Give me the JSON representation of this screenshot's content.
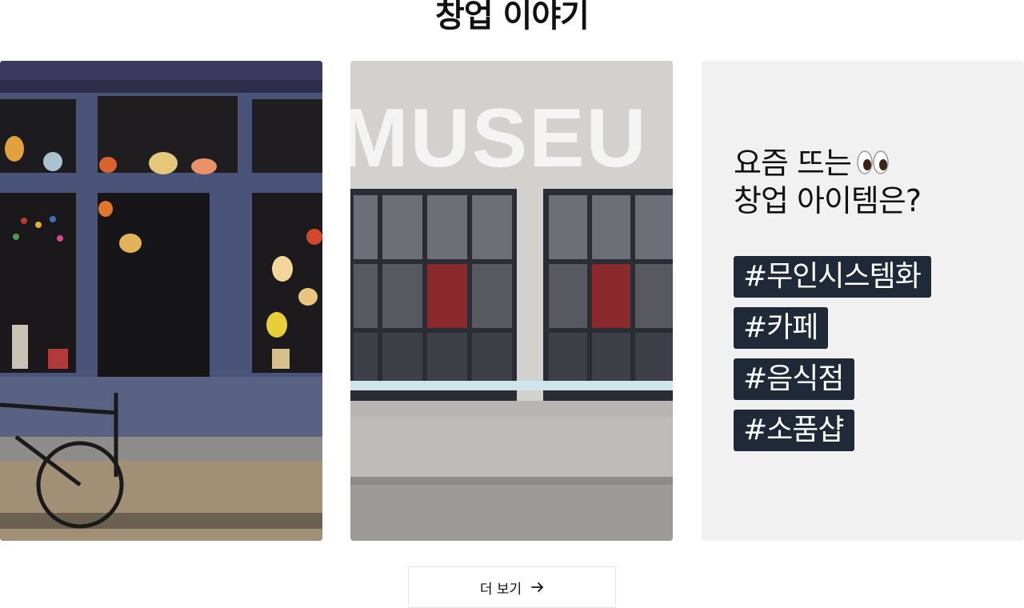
{
  "section": {
    "title": "창업 이야기"
  },
  "cards": [
    {
      "image_subject": "storefront-with-lamps-and-bicycle"
    },
    {
      "image_subject": "museum-building-facade",
      "sign_text": "MUSEU"
    },
    {
      "heading_line1": "요즘 뜨는",
      "heading_line2": "창업 아이템은?",
      "tags": [
        "#무인시스템화",
        "#카페",
        "#음식점",
        "#소품샵"
      ]
    }
  ],
  "more_button": {
    "label": "더 보기",
    "icon": "arrow-right-icon"
  },
  "colors": {
    "tag_bg": "#1f2937",
    "promo_bg": "#f1f1f1",
    "text": "#111111"
  }
}
